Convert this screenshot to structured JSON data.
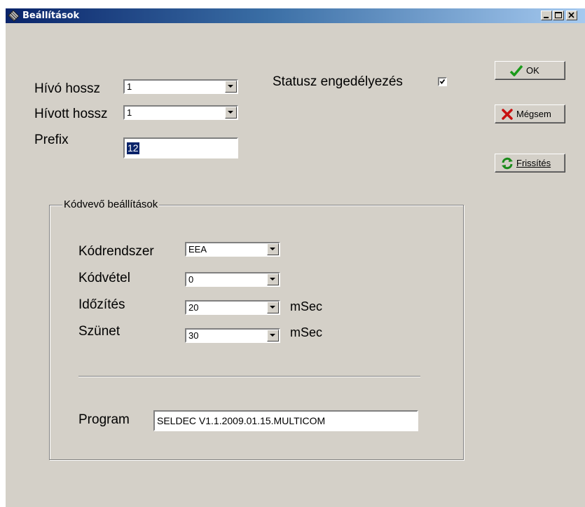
{
  "window": {
    "title": "Beállítások",
    "controls": {
      "minimize": "minimize-icon",
      "maximize": "maximize-icon",
      "close": "close-icon"
    }
  },
  "form": {
    "hivo_hossz": {
      "label": "Hívó  hossz",
      "value": "1"
    },
    "hivott_hossz": {
      "label": "Hívott hossz",
      "value": "1"
    },
    "prefix": {
      "label": "Prefix",
      "value": "12"
    },
    "statusz": {
      "label": "Statusz engedélyezés",
      "checked": true
    }
  },
  "buttons": {
    "ok": {
      "label": "OK",
      "icon": "checkmark-icon"
    },
    "megsem": {
      "label": "Mégsem",
      "icon": "x-icon"
    },
    "frissites": {
      "label": "Frissítés",
      "icon": "refresh-icon",
      "accelerator": "F"
    }
  },
  "group": {
    "title": "Kódvevő beállítások",
    "kodrendszer": {
      "label": "Kódrendszer",
      "value": "EEA"
    },
    "kodvetel": {
      "label": "Kódvétel",
      "value": "0"
    },
    "idozites": {
      "label": "Időzítés",
      "value": "20",
      "unit": "mSec"
    },
    "szunet": {
      "label": "Szünet",
      "value": "30",
      "unit": "mSec"
    },
    "program": {
      "label": "Program",
      "value": "SELDEC V1.1.2009.01.15.MULTICOM"
    }
  },
  "colors": {
    "titlebar_start": "#0a246a",
    "titlebar_end": "#a6caf0",
    "face": "#d4d0c8",
    "selection": "#0a246a",
    "ok_green": "#1a9a1a",
    "cancel_red": "#c81010"
  }
}
